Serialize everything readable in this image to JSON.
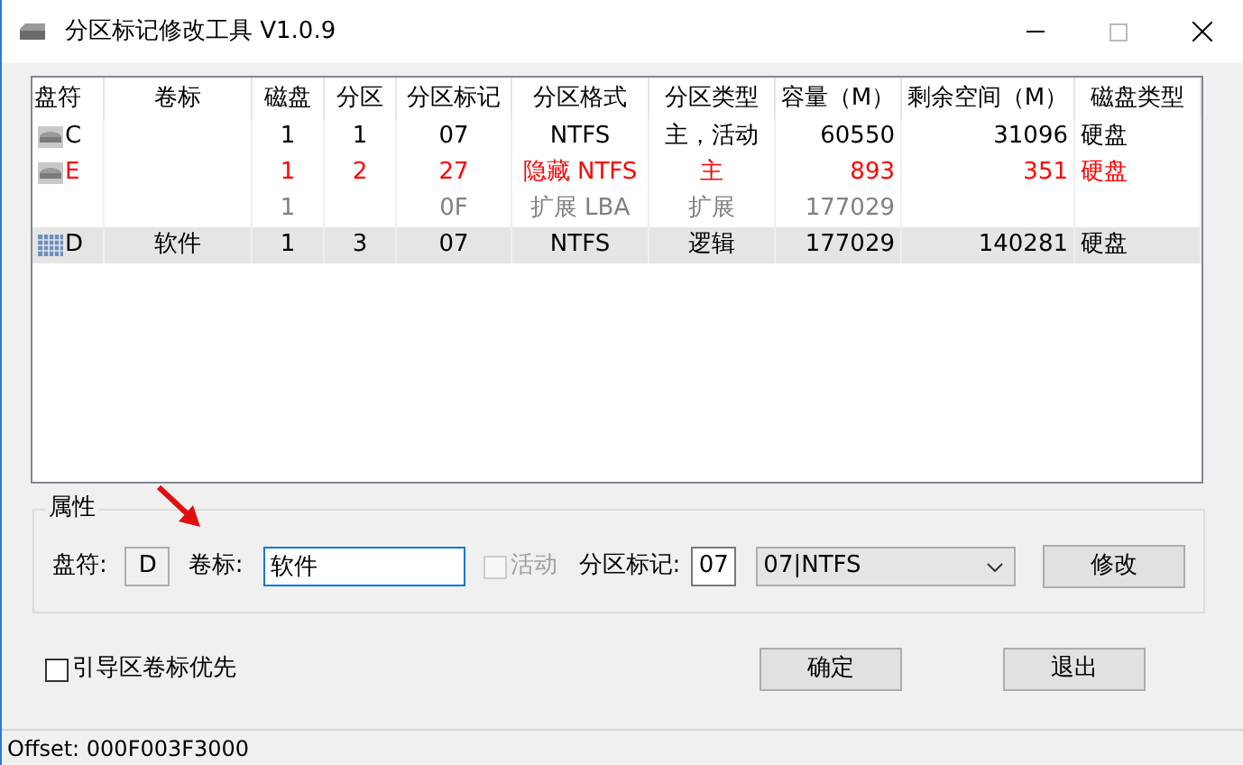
{
  "window": {
    "title": "分区标记修改工具 V1.0.9"
  },
  "table": {
    "columns": [
      "盘符",
      "卷标",
      "磁盘",
      "分区",
      "分区标记",
      "分区格式",
      "分区类型",
      "容量（M）",
      "剩余空间（M）",
      "磁盘类型"
    ],
    "rows": [
      {
        "kind": "primary",
        "selected": false,
        "cells": [
          "C",
          "",
          "1",
          "1",
          "07",
          "NTFS",
          "主，活动",
          "60550",
          "31096",
          "硬盘"
        ]
      },
      {
        "kind": "hidden",
        "selected": false,
        "cells": [
          "E",
          "",
          "1",
          "2",
          "27",
          "隐藏 NTFS",
          "主",
          "893",
          "351",
          "硬盘"
        ]
      },
      {
        "kind": "extended",
        "selected": false,
        "cells": [
          "",
          "",
          "1",
          "",
          "0F",
          "扩展 LBA",
          "扩展",
          "177029",
          "",
          ""
        ]
      },
      {
        "kind": "logical",
        "selected": true,
        "cells": [
          "D",
          "软件",
          "1",
          "3",
          "07",
          "NTFS",
          "逻辑",
          "177029",
          "140281",
          "硬盘"
        ]
      }
    ]
  },
  "properties": {
    "title": "属性",
    "drive_label": "盘符:",
    "drive_value": "D",
    "volume_label": "卷标:",
    "volume_value": "软件",
    "active_label": "活动",
    "active_checked": false,
    "active_disabled": true,
    "tag_label": "分区标记:",
    "tag_value": "07",
    "type_value": "07|NTFS",
    "modify_button": "修改"
  },
  "boot_priority": {
    "label": "引导区卷标优先",
    "checked": false
  },
  "buttons": [
    "确定",
    "退出"
  ],
  "status_bar": "Offset: 000F003F3000"
}
